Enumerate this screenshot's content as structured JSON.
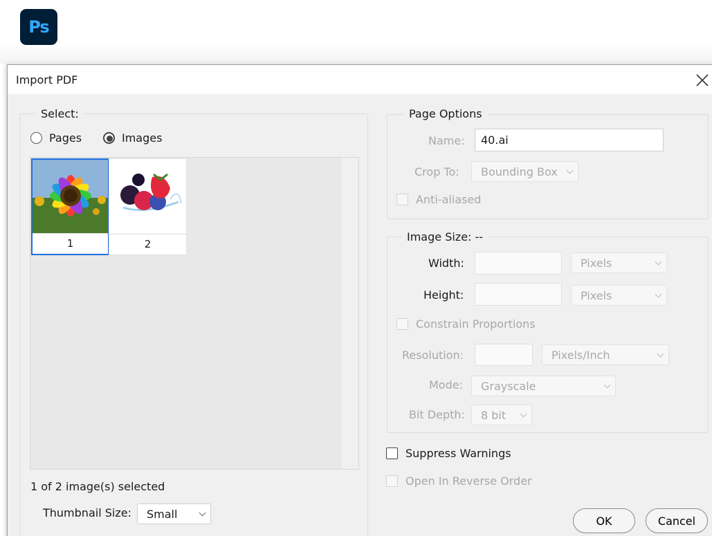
{
  "app": {
    "logo_text": "Ps",
    "logo_icon": "photoshop-icon"
  },
  "dialog": {
    "title": "Import PDF",
    "close_icon": "close-icon"
  },
  "select_group": {
    "legend": "Select:",
    "options": [
      {
        "label": "Pages",
        "checked": false
      },
      {
        "label": "Images",
        "checked": true
      }
    ],
    "thumbnails": [
      {
        "label": "1",
        "selected": true,
        "image": "sunflower"
      },
      {
        "label": "2",
        "selected": false,
        "image": "berries"
      }
    ],
    "status": "1 of 2 image(s) selected",
    "thumbnail_size_label": "Thumbnail Size:",
    "thumbnail_size_value": "Small"
  },
  "page_options": {
    "legend": "Page Options",
    "name_label": "Name:",
    "name_value": "40.ai",
    "crop_label": "Crop To:",
    "crop_value": "Bounding Box",
    "anti_aliased_label": "Anti-aliased"
  },
  "image_size": {
    "legend": "Image Size: --",
    "width_label": "Width:",
    "width_value": "",
    "width_unit": "Pixels",
    "height_label": "Height:",
    "height_value": "",
    "height_unit": "Pixels",
    "constrain_label": "Constrain Proportions",
    "resolution_label": "Resolution:",
    "resolution_value": "",
    "resolution_unit": "Pixels/Inch",
    "mode_label": "Mode:",
    "mode_value": "Grayscale",
    "bit_depth_label": "Bit Depth:",
    "bit_depth_value": "8 bit"
  },
  "options": {
    "suppress_warnings_label": "Suppress Warnings",
    "reverse_order_label": "Open In Reverse Order"
  },
  "buttons": {
    "ok": "OK",
    "cancel": "Cancel"
  },
  "colors": {
    "selection_border": "#1f6fdc",
    "annotation": "#e0161b",
    "ps_bg": "#001e36",
    "ps_fg": "#31a8ff"
  }
}
